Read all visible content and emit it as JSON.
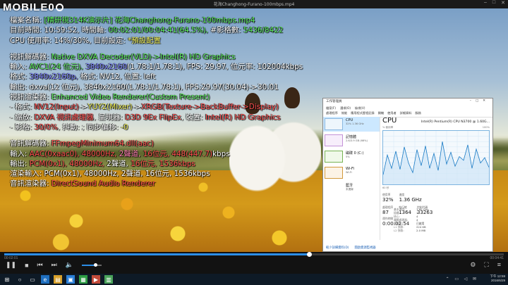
{
  "window": {
    "title": "花海Changhong-Furano-100mbps.mp4",
    "logo": "MOBILE01"
  },
  "osd": {
    "file_label": "檔案名稱:",
    "file_value": "[精研視314K演示片] 花海Changhong-Furano-100mbps.mp4",
    "time_label": "目前時間:",
    "time_clock": "10:59:52,",
    "time_axis_label": "時間軸:",
    "time_axis_value": "00:02:01/00:04:41(64.5%),",
    "frames_label": "#影格數:",
    "frames_value": "5436/8422",
    "cpu_line": "CPU 使用率: 14%/30%, 目前設定:",
    "cpu_setting": "*預設配置",
    "vdec_label": "視訊解碼器:",
    "vdec_value": "Native DXVA Decoder(VLD)->Intel(R) HD Graphics",
    "input_label": "輸入:",
    "input_codec": "AVC1(24 位元),",
    "input_res": "3840x2160",
    "input_rest": "(1.78:1/1.78:1), FPS: 29.97, 位元率: 102004kbps",
    "format_label": "格式:",
    "format_value": "3840x2160p,",
    "format_rest": "格式: NV12, 位置: left",
    "output_line": "輸出: dxva(12 位元), 3840x2160(1.78:1/1.78:1), FPS:29.97(30.04)->30.01",
    "vrend_label": "視訊渲染器:",
    "vrend_value": "Enhanced Video Renderer(Custom Present)",
    "fmt_label": "- 格式:",
    "fmt_a": "NV12(Input)",
    "fmt_b": "->",
    "fmt_c": "YUY2(Mixer)",
    "fmt_d": "->",
    "fmt_e": "XRGB(Texture->BackBuffer->Display)",
    "scale_label": "- 縮放:",
    "scale_value": "DXVA 視訊處理器",
    "scale_present": ", 呈現器:",
    "scale_present_val": "D3D 9Ex FlipEx",
    "scale_device": ", 裝置:",
    "scale_device_val": "Intel(R) HD Graphics",
    "frame_label": "- 影格:",
    "frame_value": "30/0%",
    "frame_rest": ", 抖動:   ;  同步偏移:",
    "frame_sync": "-0",
    "adec_label": "音訊解碼器:",
    "adec_value": "FFmpegMinimum64.dll(aac)",
    "ain_label": "輸入:",
    "ain_codec": "AAC(0xaac0),",
    "ain_hz": "48000Hz,",
    "ain_ch": "2聲道,",
    "ain_bits": "16位元,",
    "ain_rate": "448(447.7)",
    "ain_unit": "kbps",
    "aout_label": "輸出:",
    "aout_codec": "PCM(0x1),",
    "aout_hz": "48000Hz,",
    "aout_ch": "2聲道,",
    "aout_bits": "16位元,",
    "aout_rate": "1536kbps",
    "rin_line": "渲染輸入: PCM(0x1), 48000Hz, 2聲道, 16位元, 1536kbps",
    "arend_label": "音訊渲染器:",
    "arend_value": "DirectSound Audio Renderer"
  },
  "taskmgr": {
    "title": "工作管理員",
    "menu": [
      "檔案(F)",
      "選項(O)",
      "檢視(V)"
    ],
    "tabs": [
      "處理程序",
      "效能",
      "應用程式歷程記錄",
      "開機",
      "使用者",
      "詳細資料",
      "服務"
    ],
    "items": [
      {
        "name": "CPU",
        "sub": "32% 1.36 GHz"
      },
      {
        "name": "記憶體",
        "sub": "2.6/3.9 GB (66%)"
      },
      {
        "name": "磁碟 0 (C:)",
        "sub": "5%"
      },
      {
        "name": "Wi-Fi",
        "sub": "Wi-Fi"
      },
      {
        "name": "藍牙",
        "sub": "未連線"
      }
    ],
    "cpu_title": "CPU",
    "cpu_model": "Intel(R) Pentium(R) CPU N3700 @ 1.60G...",
    "graph_label": "% 使用率",
    "graph_max": "100%",
    "graph_time": "60 秒",
    "stat_util_k": "使用率",
    "stat_util_v": "32%",
    "stat_speed_k": "速度",
    "stat_speed_v": "1.36 GHz",
    "stat_proc_k": "處理程序",
    "stat_proc_v": "87",
    "stat_thr_k": "執行緒",
    "stat_thr_v": "1364",
    "stat_hnd_k": "控制代碼",
    "stat_hnd_v": "33263",
    "uptime_k": "運作時間",
    "uptime_v": "0:00:02:54",
    "specs": [
      {
        "k": "基本速度:",
        "v": "1.60 GHz"
      },
      {
        "k": "插槽:",
        "v": "1"
      },
      {
        "k": "核心:",
        "v": "4"
      },
      {
        "k": "邏輯處理器:",
        "v": "4"
      },
      {
        "k": "虛擬化:",
        "v": "已啟用"
      },
      {
        "k": "L1 快取:",
        "v": "224 KB"
      },
      {
        "k": "L2 快取:",
        "v": "2.0 MB"
      }
    ],
    "footer_less": "較少詳細資料(D)",
    "footer_monitor": "開啟資源監視器",
    "cpu_history": [
      18,
      55,
      30,
      62,
      28,
      70,
      40,
      22,
      65,
      35,
      72,
      30,
      58,
      26,
      80,
      38,
      60,
      34,
      52,
      45,
      74,
      30,
      66,
      40,
      50,
      32
    ]
  },
  "player": {
    "current_time": "00:02:01",
    "total_time": "00:04:41",
    "progress_pct": 61,
    "volume_pct": 65
  },
  "taskbar": {
    "time": "下午 12:59",
    "date": "2016/6/29"
  }
}
